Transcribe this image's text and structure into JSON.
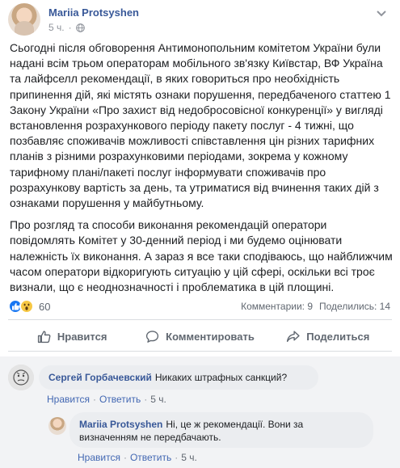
{
  "post": {
    "author": "Mariia Protsyshen",
    "time": "5 ч.",
    "paragraphs": [
      "Сьогодні після обговорення Антимонопольним комітетом України були надані всім трьом операторам мобільного зв'язку Київстар, ВФ Україна та лайфселл рекомендації, в яких говориться про необхідність припинення дій, які містять ознаки порушення, передбаченого статтею 1 Закону України «Про захист від недобросовісної конкуренції» у вигляді встановлення розрахункового періоду пакету послуг - 4 тижні, що позбавляє споживачів можливості співставлення цін різних тарифних планів з різними розрахунковими періодами, зокрема у кожному тарифному плані/пакеті послуг інформувати споживачів про розрахункову вартість за день, та утриматися від вчинення таких дій з ознаками порушення у майбутньому.",
      "Про розгляд та способи виконання рекомендацій оператори повідомлять Комітет у 30-денний період і ми будемо оцінювати належність їх виконання. А зараз я все таки сподіваюсь, що найближчим часом оператори відкоригують ситуацію у цій сфері, оскільки всі троє визнали, що є неоднозначності і проблематика в цій площині."
    ]
  },
  "stats": {
    "reaction_count": "60",
    "comments": "Комментарии: 9",
    "shares": "Поделились: 14",
    "reaction_icons": [
      "like-icon",
      "wow-icon"
    ]
  },
  "actions": {
    "like": "Нравится",
    "comment": "Комментировать",
    "share": "Поделиться"
  },
  "comments": [
    {
      "author": "Сергей Горбачевский",
      "text": "Никаких штрафных санкций?",
      "like": "Нравится",
      "reply": "Ответить",
      "time": "5 ч."
    },
    {
      "author": "Mariia Protsyshen",
      "text": "Ні, це ж рекомендації. Вони за визначенням не передбачають.",
      "like": "Нравится",
      "reply": "Ответить",
      "time": "5 ч."
    }
  ],
  "colors": {
    "link": "#385898",
    "like_blue": "#1877f2",
    "wow_yellow": "#f7c844"
  }
}
